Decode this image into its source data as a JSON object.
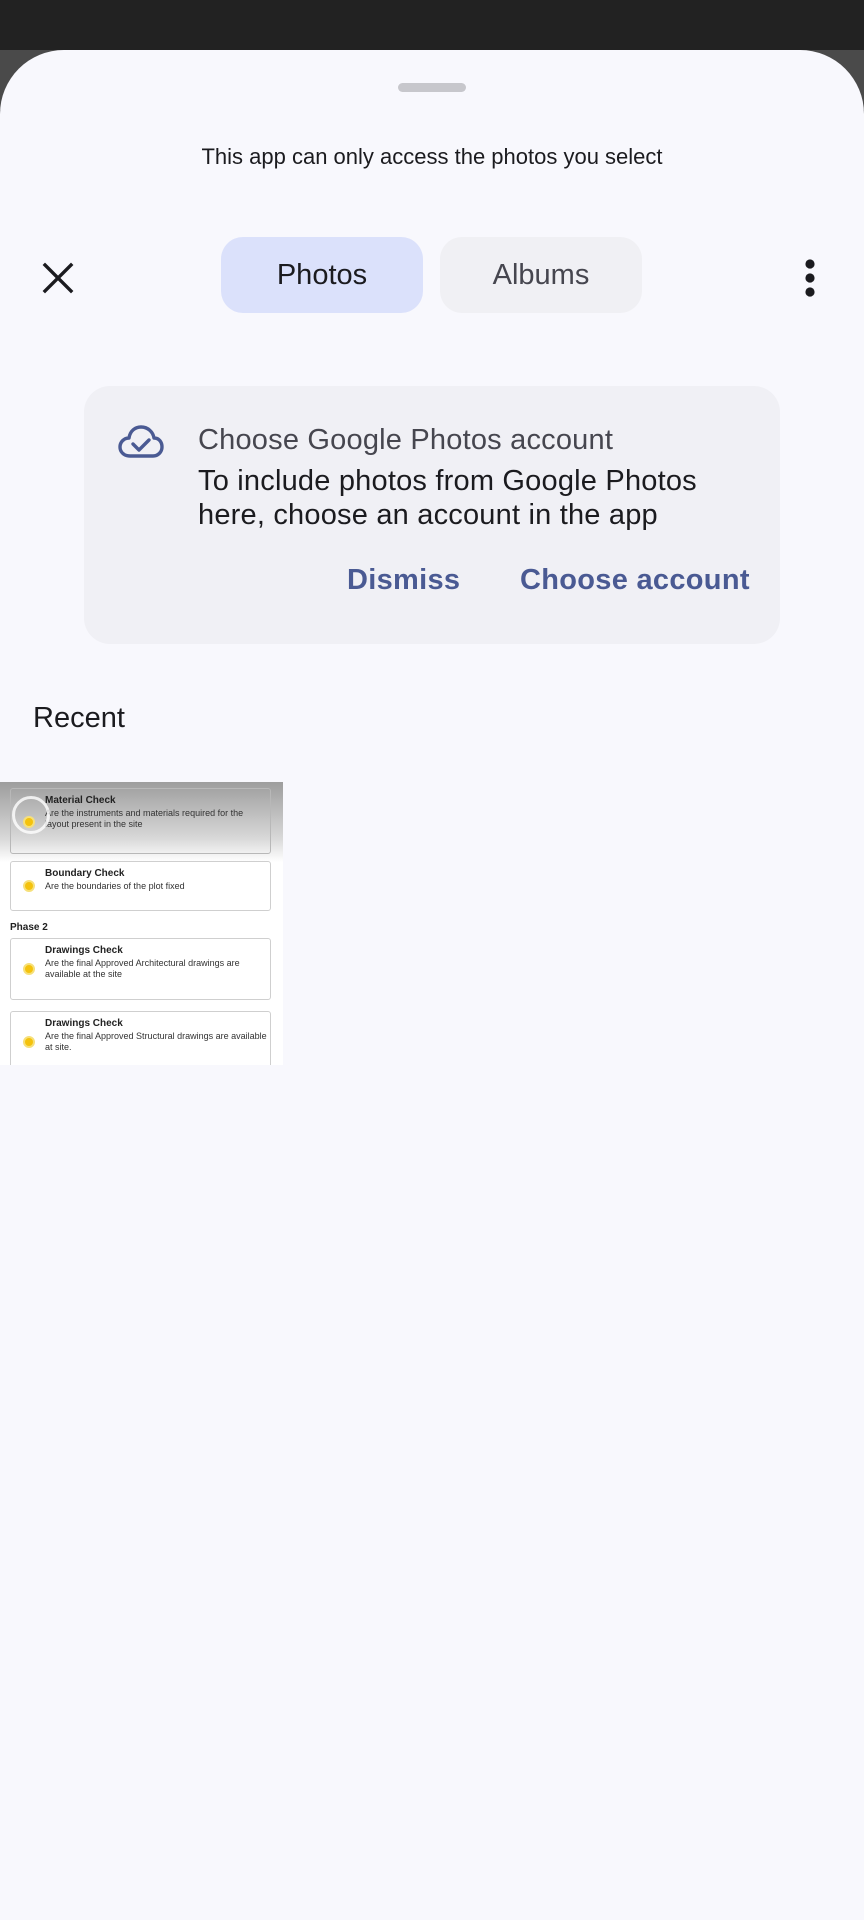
{
  "sheet": {
    "subtitle": "This app can only access the photos you select"
  },
  "tabs": [
    {
      "label": "Photos",
      "selected": true
    },
    {
      "label": "Albums",
      "selected": false
    }
  ],
  "icons": {
    "close": "close-icon",
    "more": "more-vert-icon",
    "cloud": "cloud-done-icon"
  },
  "banner": {
    "title": "Choose Google Photos account",
    "body": "To include photos from Google Photos here, choose an account in the app",
    "dismiss_label": "Dismiss",
    "choose_label": "Choose account"
  },
  "recent": {
    "title": "Recent",
    "thumbnail": {
      "cards": [
        {
          "title": "Material Check",
          "desc": "Are the instruments and materials required for the layout present in the site"
        },
        {
          "title": "Boundary Check",
          "desc": "Are the boundaries of the plot fixed"
        },
        {
          "title": "Drawings Check",
          "desc": "Are the final Approved Architectural drawings are available at the site"
        },
        {
          "title": "Drawings Check",
          "desc": "Are the final Approved Structural drawings are available at site."
        }
      ],
      "phase_label": "Phase 2"
    }
  },
  "colors": {
    "accent": "#4a5a93",
    "selected_tab": "#dbe1fb",
    "sheet_bg": "#f8f8fd",
    "banner_bg": "#f0f0f5"
  }
}
